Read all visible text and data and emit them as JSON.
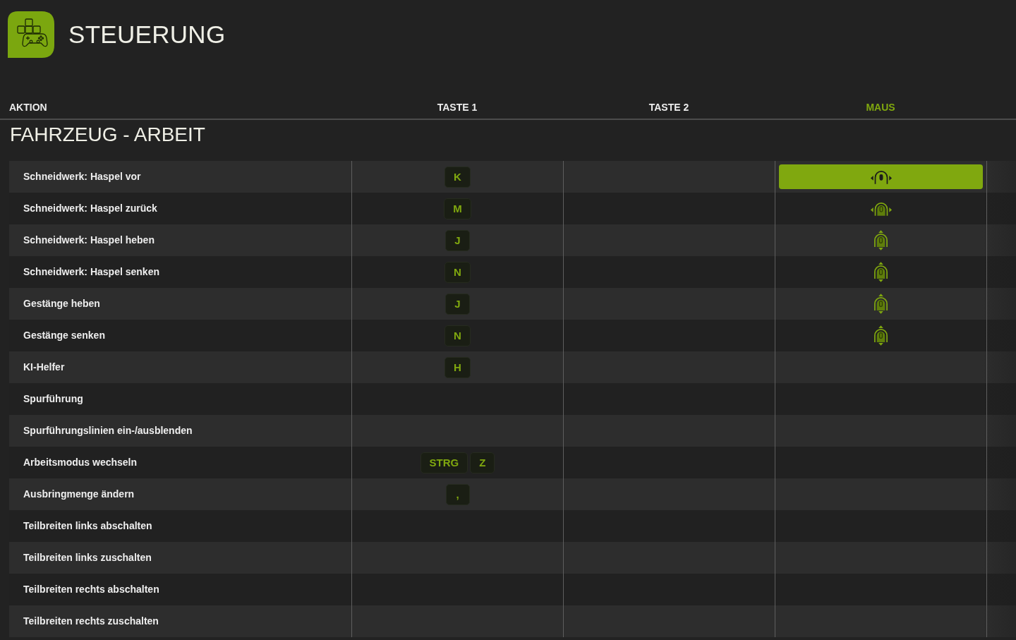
{
  "header": {
    "title": "STEUERUNG"
  },
  "columns": [
    {
      "label": "AKTION",
      "selected": false
    },
    {
      "label": "TASTE 1",
      "selected": false
    },
    {
      "label": "TASTE 2",
      "selected": false
    },
    {
      "label": "MAUS",
      "selected": true
    }
  ],
  "section": {
    "title": "FAHRZEUG - ARBEIT"
  },
  "rows": [
    {
      "action": "Schneidwerk: Haspel vor",
      "key1": [
        "K"
      ],
      "mouse": {
        "kind": "horizontal",
        "selected": true
      }
    },
    {
      "action": "Schneidwerk: Haspel zurück",
      "key1": [
        "M"
      ],
      "mouse": {
        "kind": "horizontal",
        "selected": false
      }
    },
    {
      "action": "Schneidwerk: Haspel heben",
      "key1": [
        "J"
      ],
      "mouse": {
        "kind": "vertical",
        "selected": false
      }
    },
    {
      "action": "Schneidwerk: Haspel senken",
      "key1": [
        "N"
      ],
      "mouse": {
        "kind": "vertical",
        "selected": false
      }
    },
    {
      "action": "Gestänge heben",
      "key1": [
        "J"
      ],
      "mouse": {
        "kind": "vertical",
        "selected": false
      }
    },
    {
      "action": "Gestänge senken",
      "key1": [
        "N"
      ],
      "mouse": {
        "kind": "vertical",
        "selected": false
      }
    },
    {
      "action": "KI-Helfer",
      "key1": [
        "H"
      ]
    },
    {
      "action": "Spurführung"
    },
    {
      "action": "Spurführungslinien ein-/ausblenden"
    },
    {
      "action": "Arbeitsmodus wechseln",
      "key1": [
        "STRG",
        "Z"
      ]
    },
    {
      "action": "Ausbringmenge ändern",
      "key1": [
        ","
      ]
    },
    {
      "action": "Teilbreiten links abschalten"
    },
    {
      "action": "Teilbreiten links zuschalten"
    },
    {
      "action": "Teilbreiten rechts abschalten"
    },
    {
      "action": "Teilbreiten rechts zuschalten"
    }
  ]
}
